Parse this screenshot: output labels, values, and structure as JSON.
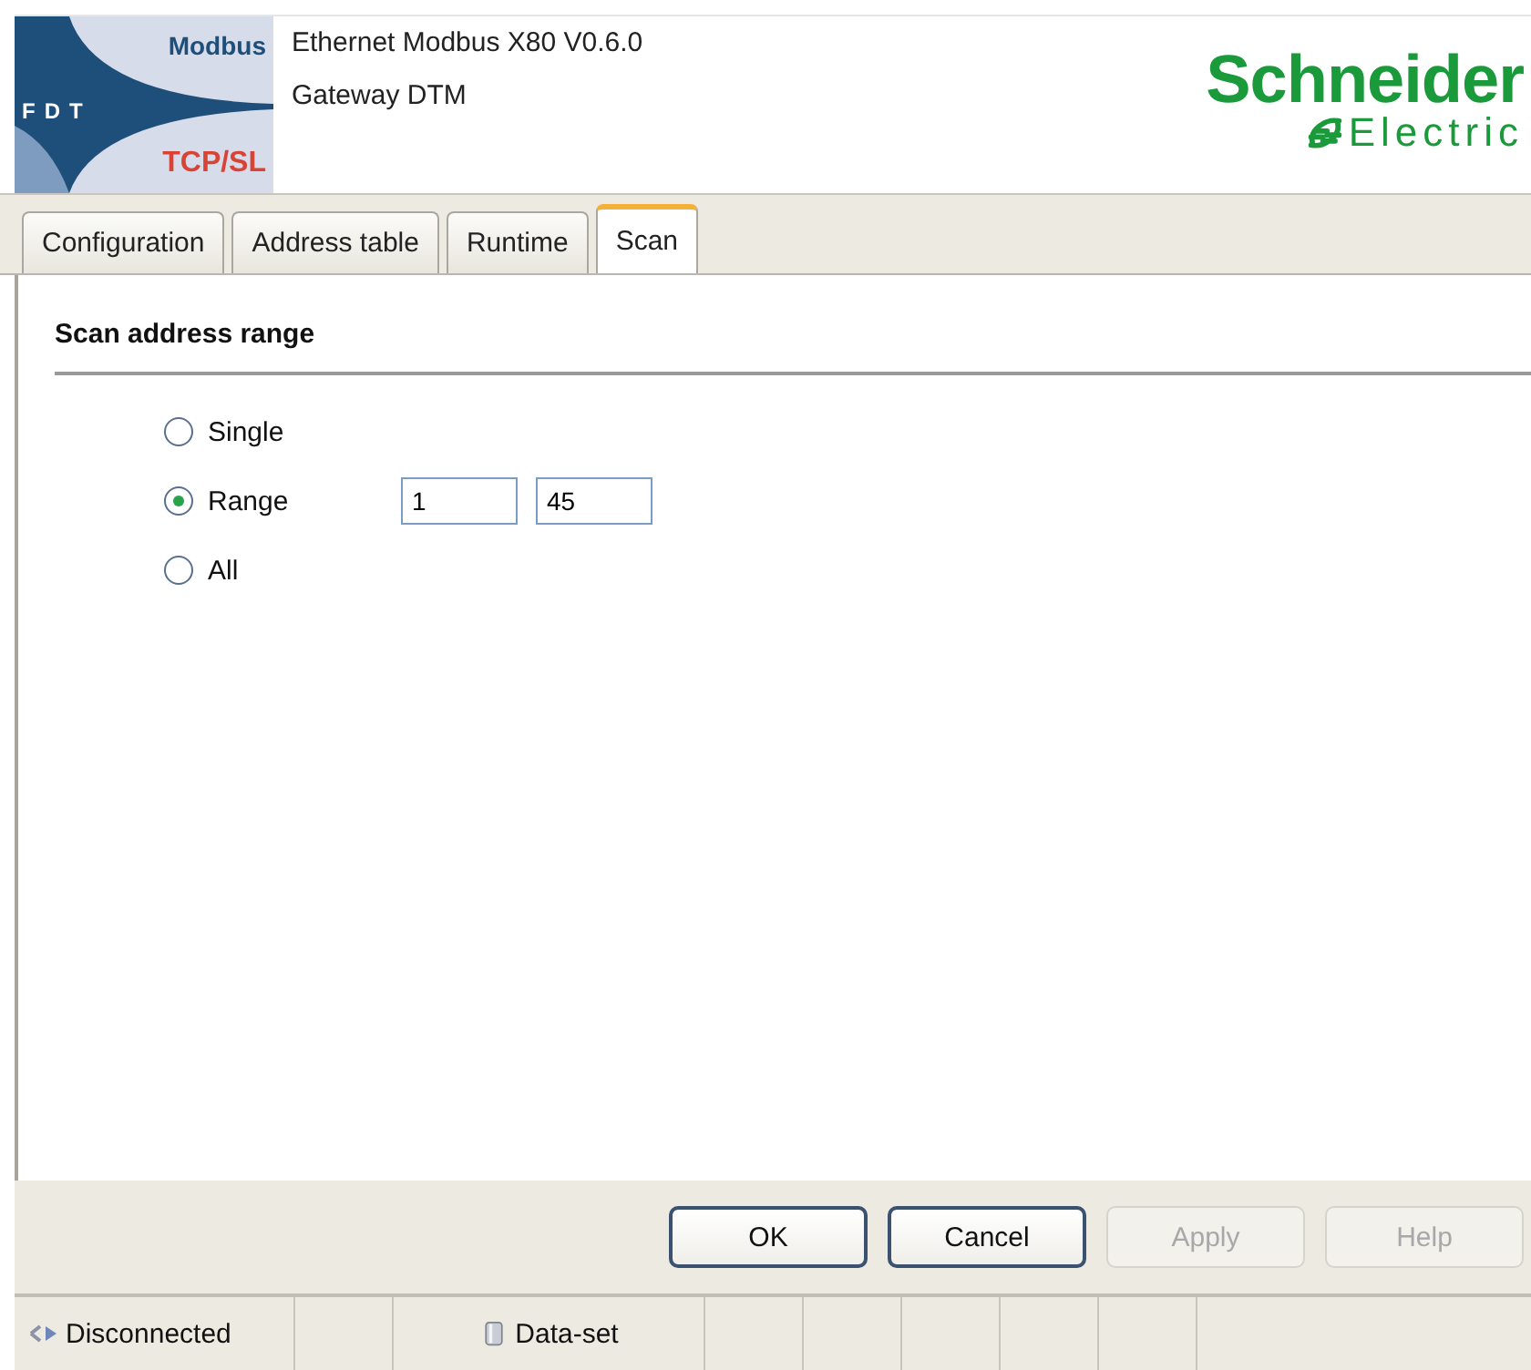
{
  "header": {
    "logo": {
      "top": "Modbus",
      "middle": "FDT",
      "bottom": "TCP/SL"
    },
    "title": "Ethernet Modbus X80 V0.6.0",
    "subtitle": "Gateway DTM",
    "brand": {
      "name": "Schneider",
      "sub": "Electric"
    }
  },
  "tabs": [
    {
      "label": "Configuration",
      "selected": false
    },
    {
      "label": "Address table",
      "selected": false
    },
    {
      "label": "Runtime",
      "selected": false
    },
    {
      "label": "Scan",
      "selected": true
    }
  ],
  "section": {
    "title": "Scan address range"
  },
  "options": [
    {
      "label": "Single",
      "selected": false
    },
    {
      "label": "Range",
      "selected": true,
      "fields": [
        "1",
        "45"
      ]
    },
    {
      "label": "All",
      "selected": false
    }
  ],
  "buttons": [
    {
      "label": "OK",
      "disabled": false
    },
    {
      "label": "Cancel",
      "disabled": false
    },
    {
      "label": "Apply",
      "disabled": true
    },
    {
      "label": "Help",
      "disabled": true
    }
  ],
  "status_bar": [
    {
      "kind": "connection",
      "text": "Disconnected"
    },
    {
      "kind": "empty"
    },
    {
      "kind": "dataset",
      "text": "Data-set"
    },
    {
      "kind": "empty"
    },
    {
      "kind": "empty"
    },
    {
      "kind": "empty"
    },
    {
      "kind": "empty"
    },
    {
      "kind": "empty"
    }
  ]
}
